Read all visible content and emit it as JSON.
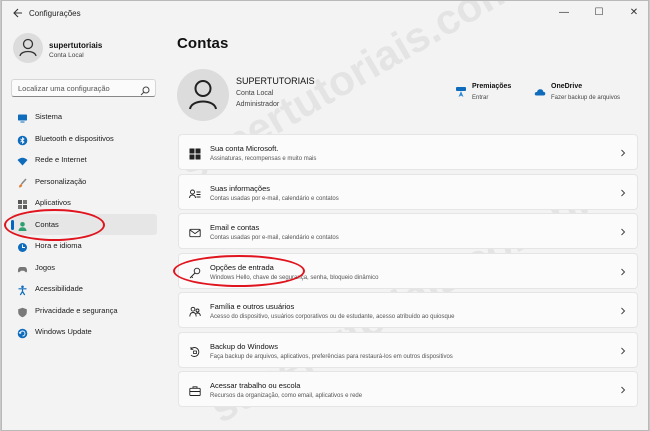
{
  "app": {
    "title": "Configurações"
  },
  "window_controls": {
    "minimize": "—",
    "maximize": "☐",
    "close": "✕"
  },
  "user": {
    "name": "supertutoriais",
    "account_type": "Conta Local"
  },
  "search": {
    "placeholder": "Localizar uma configuração"
  },
  "sidebar": {
    "items": [
      {
        "label": "Sistema",
        "icon": "monitor-icon"
      },
      {
        "label": "Bluetooth e dispositivos",
        "icon": "bluetooth-icon"
      },
      {
        "label": "Rede e Internet",
        "icon": "wifi-icon"
      },
      {
        "label": "Personalização",
        "icon": "brush-icon"
      },
      {
        "label": "Aplicativos",
        "icon": "apps-icon"
      },
      {
        "label": "Contas",
        "icon": "person-icon",
        "selected": true
      },
      {
        "label": "Hora e idioma",
        "icon": "globe-clock-icon"
      },
      {
        "label": "Jogos",
        "icon": "gamepad-icon"
      },
      {
        "label": "Acessibilidade",
        "icon": "accessibility-icon"
      },
      {
        "label": "Privacidade e segurança",
        "icon": "shield-icon"
      },
      {
        "label": "Windows Update",
        "icon": "update-icon"
      }
    ]
  },
  "page": {
    "title": "Contas"
  },
  "profile": {
    "name": "SUPERTUTORIAIS",
    "line1": "Conta Local",
    "line2": "Administrador"
  },
  "quick_links": [
    {
      "title": "Premiações",
      "subtitle": "Entrar",
      "icon": "rewards-icon"
    },
    {
      "title": "OneDrive",
      "subtitle": "Fazer backup de arquivos",
      "icon": "cloud-icon"
    }
  ],
  "cards": [
    {
      "title": "Sua conta Microsoft.",
      "subtitle": "Assinaturas, recompensas e muito mais",
      "icon": "windows-logo-icon"
    },
    {
      "title": "Suas informações",
      "subtitle": "Contas usadas por e-mail, calendário e contatos",
      "icon": "person-info-icon"
    },
    {
      "title": "Email e contas",
      "subtitle": "Contas usadas por e-mail, calendário e contatos",
      "icon": "mail-icon"
    },
    {
      "title": "Opções de entrada",
      "subtitle": "Windows Hello, chave de segurança, senha, bloqueio dinâmico",
      "icon": "key-icon"
    },
    {
      "title": "Família e outros usuários",
      "subtitle": "Acesso do dispositivo, usuários corporativos ou de estudante, acesso atribuído ao quiosque",
      "icon": "family-icon"
    },
    {
      "title": "Backup do Windows",
      "subtitle": "Faça backup de arquivos, aplicativos, preferências para restaurá-los em outros dispositivos",
      "icon": "backup-icon"
    },
    {
      "title": "Acessar trabalho ou escola",
      "subtitle": "Recursos da organização, como email, aplicativos e rede",
      "icon": "briefcase-icon"
    }
  ],
  "watermark": {
    "text": "supertutoriais.com.br"
  },
  "colors": {
    "accent": "#0067c0",
    "highlight_ring": "#e0141e"
  }
}
